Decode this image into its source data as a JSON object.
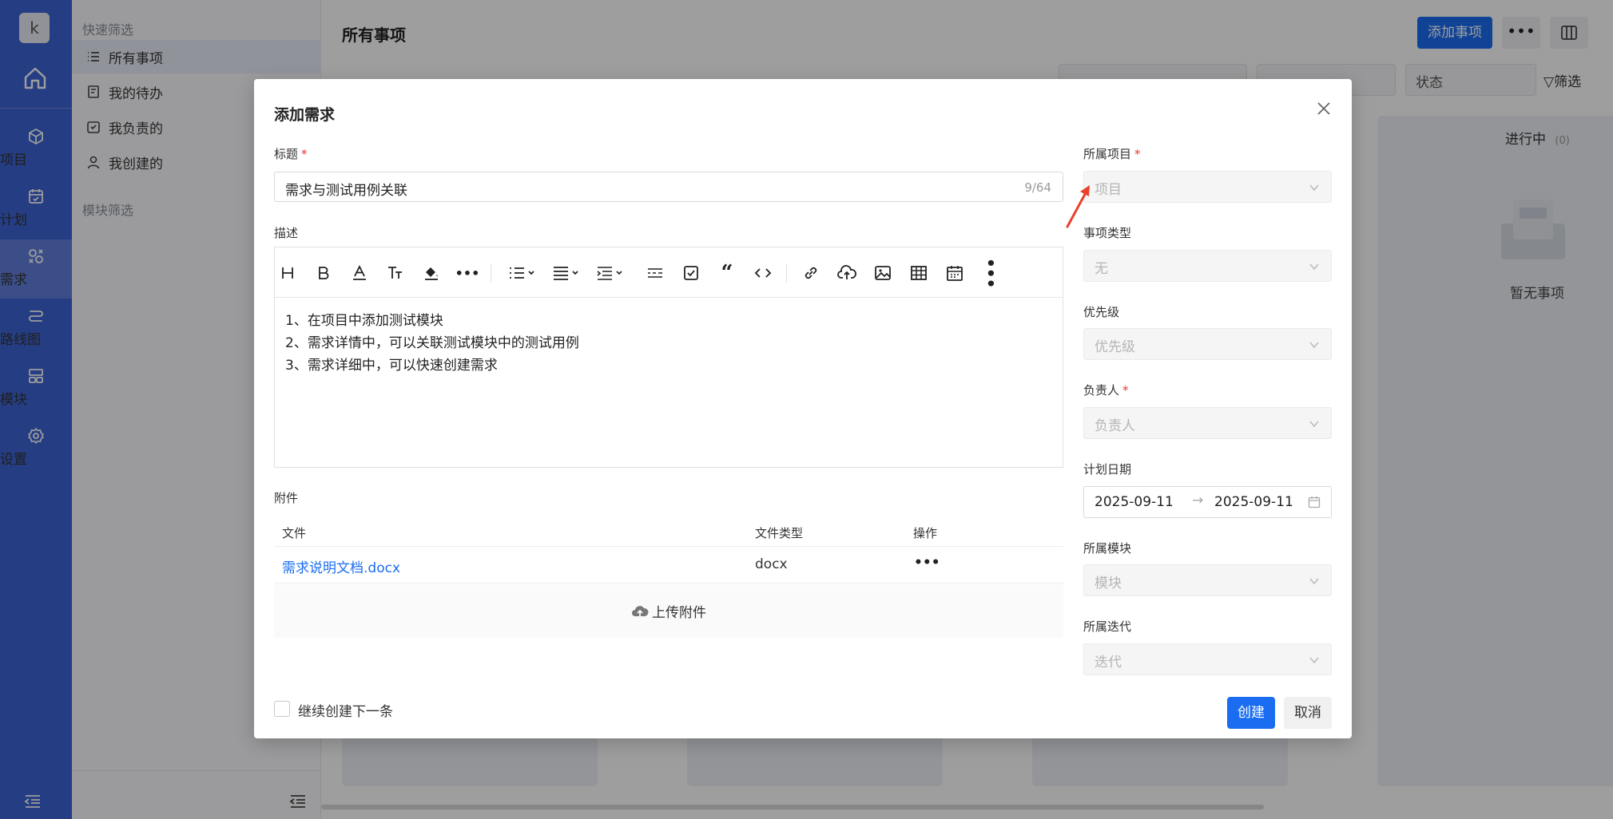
{
  "app": {
    "avatar_letter": "k",
    "nav": [
      {
        "label": "项目",
        "icon": "cube-icon"
      },
      {
        "label": "计划",
        "icon": "calendar-check-icon"
      },
      {
        "label": "需求",
        "icon": "requirement-icon"
      },
      {
        "label": "路线图",
        "icon": "roadmap-icon"
      },
      {
        "label": "模块",
        "icon": "module-icon"
      },
      {
        "label": "设置",
        "icon": "gear-icon"
      }
    ],
    "active_nav": "需求"
  },
  "sidebar": {
    "quick_filter_title": "快速筛选",
    "items": [
      {
        "label": "所有事项",
        "icon": "list-icon"
      },
      {
        "label": "我的待办",
        "icon": "todo-icon"
      },
      {
        "label": "我负责的",
        "icon": "check-square-icon"
      },
      {
        "label": "我创建的",
        "icon": "user-icon"
      }
    ],
    "module_filter_title": "模块筛选"
  },
  "main": {
    "title": "所有事项",
    "add_button": "添加事项",
    "status_filter": "状态",
    "filter_label": "筛选",
    "in_progress_label": "进行中",
    "in_progress_count": "(0)",
    "empty_label": "暂无事项"
  },
  "modal": {
    "title": "添加需求",
    "title_label": "标题",
    "title_value": "需求与测试用例关联",
    "title_count": "9/64",
    "desc_label": "描述",
    "desc_lines": [
      "1、在项目中添加测试模块",
      "2、需求详情中，可以关联测试模块中的测试用例",
      "3、需求详细中，可以快速创建需求"
    ],
    "attach_label": "附件",
    "attach_headers": {
      "file": "文件",
      "type": "文件类型",
      "action": "操作"
    },
    "attachments": [
      {
        "name": "需求说明文档.docx",
        "type": "docx"
      }
    ],
    "upload_label": "上传附件",
    "project_label": "所属项目",
    "project_placeholder": "项目",
    "type_label": "事项类型",
    "type_value": "无",
    "priority_label": "优先级",
    "priority_placeholder": "优先级",
    "owner_label": "负责人",
    "owner_placeholder": "负责人",
    "plan_date_label": "计划日期",
    "date_start": "2025-09-11",
    "date_end": "2025-09-11",
    "module_label": "所属模块",
    "module_placeholder": "模块",
    "iteration_label": "所属迭代",
    "iteration_placeholder": "迭代",
    "continue_label": "继续创建下一条",
    "create_button": "创建",
    "cancel_button": "取消"
  },
  "colors": {
    "primary": "#1a6df0",
    "rail": "#3d63d4",
    "required": "#e53935",
    "link": "#1a6df0",
    "annotation_arrow": "#e8402c"
  }
}
